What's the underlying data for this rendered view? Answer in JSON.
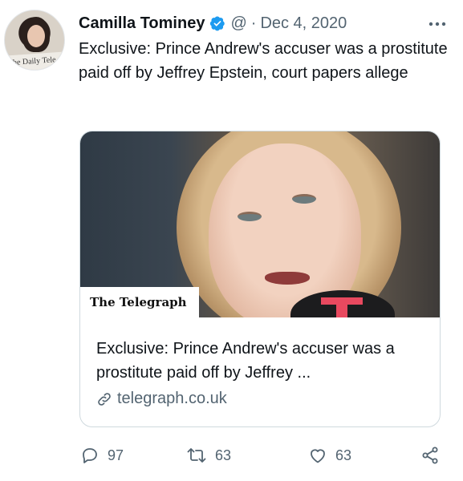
{
  "author": {
    "name": "Camilla Tominey",
    "handle": "@",
    "separator": "·",
    "date": "Dec 4, 2020",
    "avatar_paper_text": "The Daily Tele"
  },
  "tweet": {
    "text": "Exclusive: Prince Andrew's accuser was a prostitute paid off by Jeffrey Epstein, court papers allege"
  },
  "card": {
    "masthead": "The Telegraph",
    "title": "Exclusive: Prince Andrew's accuser was a prostitute paid off by Jeffrey ...",
    "domain": "telegraph.co.uk"
  },
  "actions": {
    "replies": "97",
    "retweets": "63",
    "likes": "63"
  },
  "colors": {
    "verified": "#1d9bf0",
    "secondary_text": "#536471",
    "primary_text": "#0f1419"
  },
  "icons": [
    "verified-badge-icon",
    "more-icon",
    "link-icon",
    "reply-icon",
    "retweet-icon",
    "like-icon",
    "share-icon"
  ]
}
